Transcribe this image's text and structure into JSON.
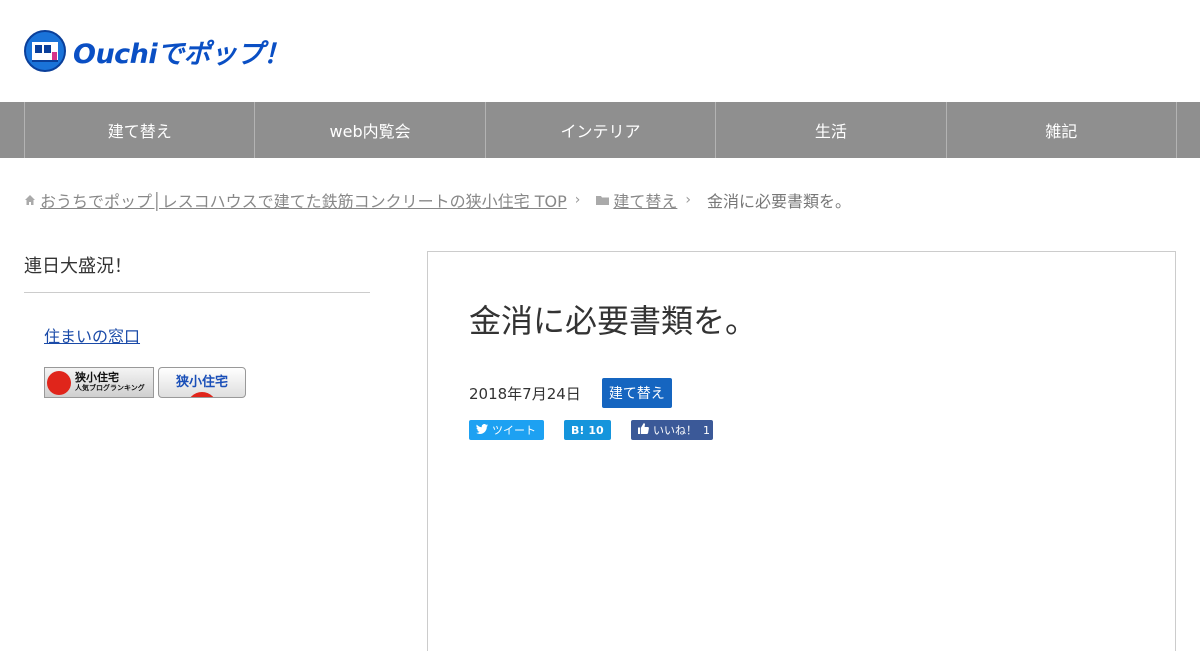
{
  "site": {
    "logo_text": "Ouchiでポップ！",
    "logo_icon": "house-window-icon"
  },
  "nav": {
    "items": [
      "建て替え",
      "web内覧会",
      "インテリア",
      "生活",
      "雑記"
    ]
  },
  "breadcrumb": {
    "home_label": "おうちでポップ│レスコハウスで建てた鉄筋コンクリートの狭小住宅 TOP",
    "category_label": "建て替え",
    "current": "金消に必要書類を。"
  },
  "sidebar": {
    "widget_title": "連日大盛況！",
    "link_label": "住まいの窓口",
    "banner1": {
      "line1": "狭小住宅",
      "line2": "人気ブログランキング"
    },
    "banner2": {
      "text": "狭小住宅"
    }
  },
  "article": {
    "title": "金消に必要書類を。",
    "date": "2018年7月24日",
    "category": "建て替え",
    "share": {
      "tweet_label": "ツイート",
      "hatena_label": "B!",
      "hatena_count": "10",
      "like_label": "いいね！",
      "like_count": "1"
    }
  },
  "colors": {
    "nav_bg": "#8f8f8f",
    "logo_blue": "#0a4fc4",
    "badge_blue": "#1565c0",
    "twitter": "#1da1f2",
    "hatena": "#1595dc",
    "facebook": "#3b5998"
  }
}
